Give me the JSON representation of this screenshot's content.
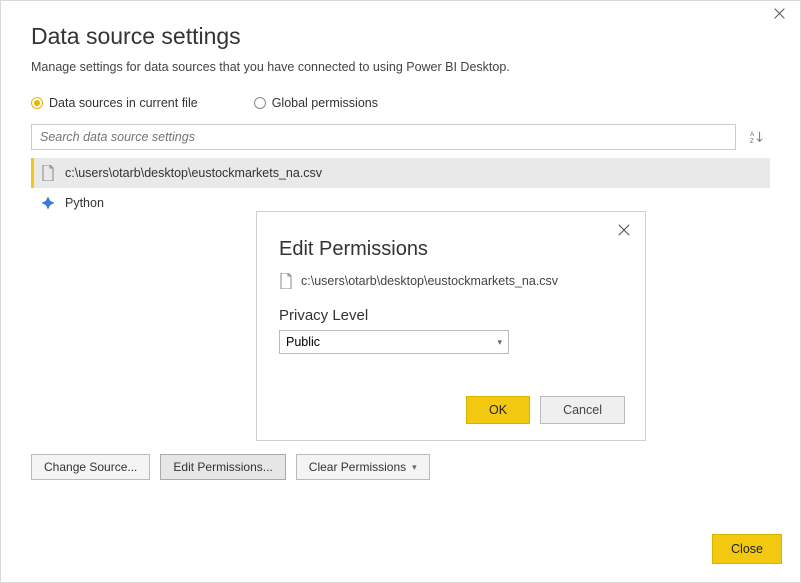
{
  "header": {
    "title": "Data source settings",
    "subtitle": "Manage settings for data sources that you have connected to using Power BI Desktop."
  },
  "radios": {
    "current_file": "Data sources in current file",
    "global_perms": "Global permissions"
  },
  "search": {
    "placeholder": "Search data source settings"
  },
  "datasources": [
    {
      "label": "c:\\users\\otarb\\desktop\\eustockmarkets_na.csv",
      "icon": "file"
    },
    {
      "label": "Python",
      "icon": "python"
    }
  ],
  "buttons": {
    "change_source": "Change Source...",
    "edit_permissions": "Edit Permissions...",
    "clear_permissions": "Clear Permissions",
    "close": "Close"
  },
  "modal": {
    "title": "Edit Permissions",
    "file": "c:\\users\\otarb\\desktop\\eustockmarkets_na.csv",
    "privacy_label": "Privacy Level",
    "privacy_value": "Public",
    "ok": "OK",
    "cancel": "Cancel"
  }
}
